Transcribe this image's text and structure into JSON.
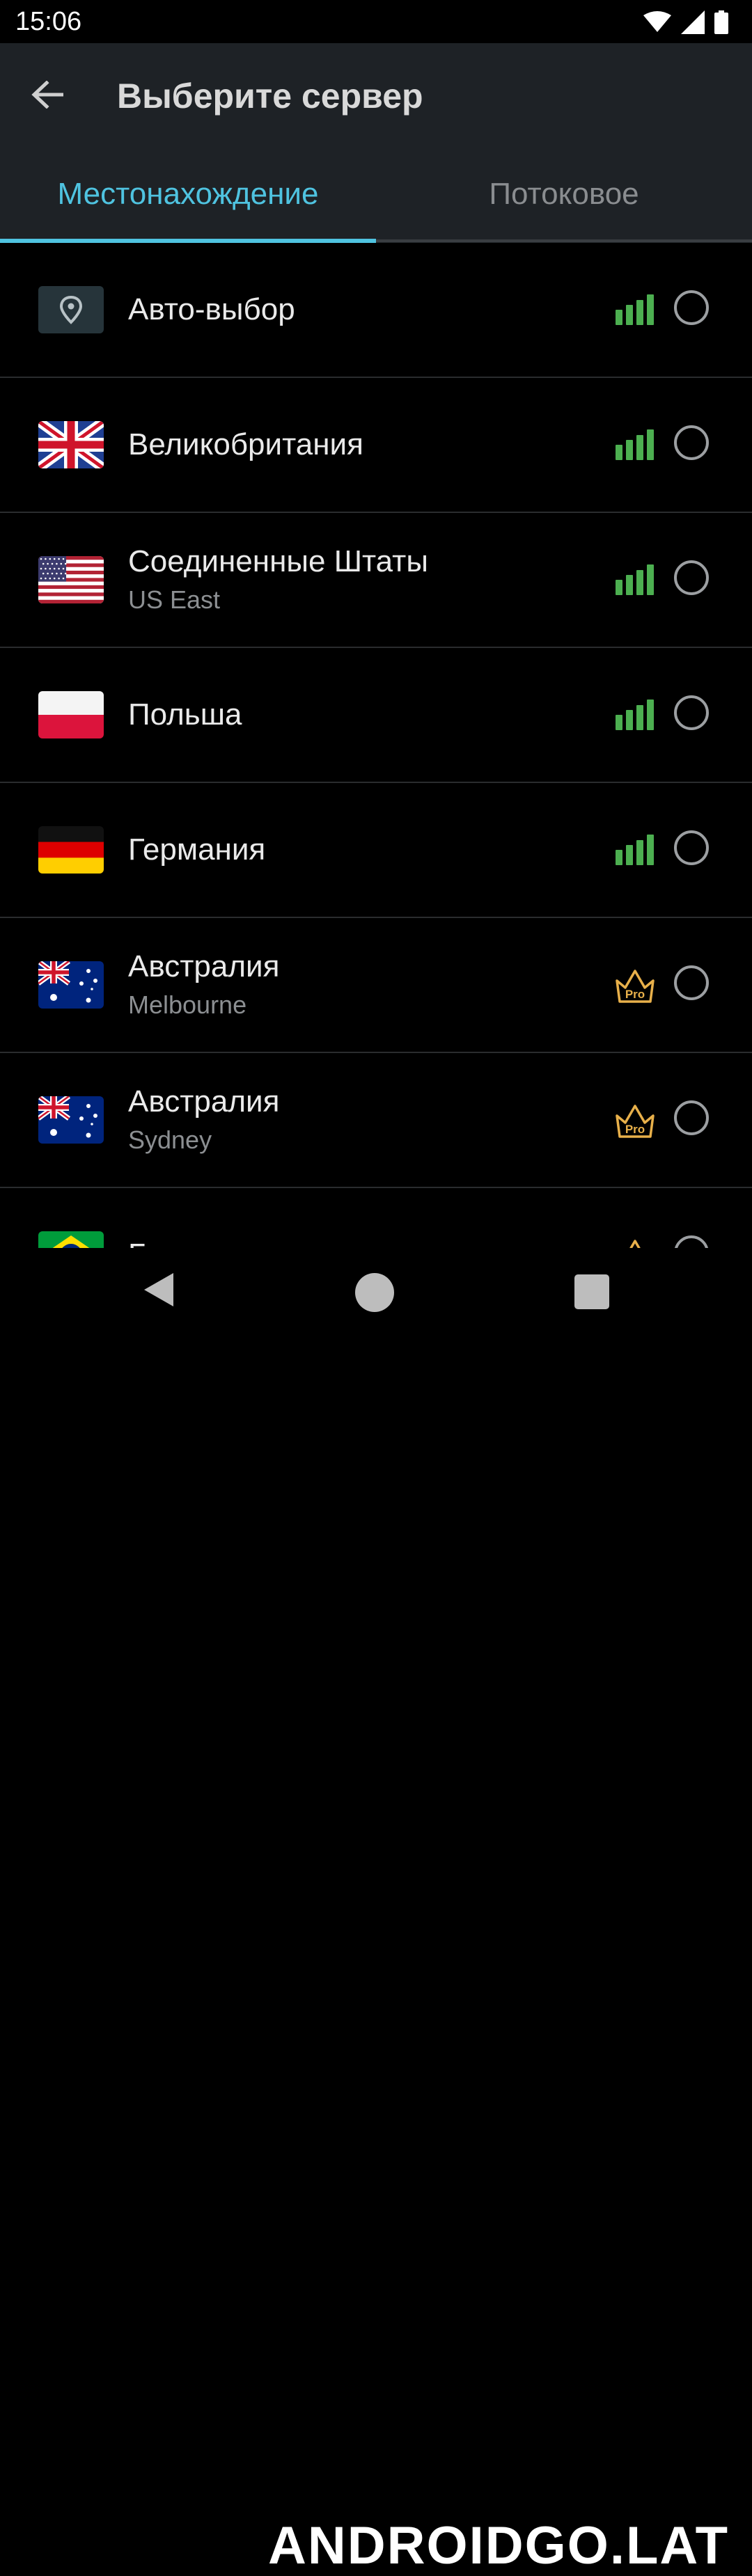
{
  "status_bar": {
    "time": "15:06",
    "icons": [
      "wifi-icon",
      "cell-signal-icon",
      "battery-icon"
    ]
  },
  "app_bar": {
    "title": "Выберите сервер",
    "back_icon": "arrow-left-icon"
  },
  "tabs": [
    {
      "label": "Местонахождение",
      "active": true
    },
    {
      "label": "Потоковое",
      "active": false
    }
  ],
  "servers": [
    {
      "name": "Авто-выбор",
      "subtitle": "",
      "icon": "location-pin-icon",
      "indicator": "signal",
      "selected": false
    },
    {
      "name": "Великобритания",
      "subtitle": "",
      "icon": "flag-uk-icon",
      "indicator": "signal",
      "selected": false
    },
    {
      "name": "Соединенные Штаты",
      "subtitle": "US East",
      "icon": "flag-us-icon",
      "indicator": "signal",
      "selected": false
    },
    {
      "name": "Польша",
      "subtitle": "",
      "icon": "flag-poland-icon",
      "indicator": "signal",
      "selected": false
    },
    {
      "name": "Германия",
      "subtitle": "",
      "icon": "flag-germany-icon",
      "indicator": "signal",
      "selected": false
    },
    {
      "name": "Австралия",
      "subtitle": "Melbourne",
      "icon": "flag-australia-icon",
      "indicator": "pro",
      "selected": false
    },
    {
      "name": "Австралия",
      "subtitle": "Sydney",
      "icon": "flag-australia-icon",
      "indicator": "pro",
      "selected": false
    },
    {
      "name": "Бразилия",
      "subtitle": "",
      "icon": "flag-brazil-icon",
      "indicator": "pro",
      "selected": false
    }
  ],
  "pro_badge_text": "Pro",
  "colors": {
    "accent": "#4fc3e0",
    "signal": "#4caf50",
    "pro": "#e8b04a",
    "appbar": "#1e2226"
  },
  "navigation_bar": {
    "icons": [
      "nav-back-icon",
      "nav-home-icon",
      "nav-recents-icon"
    ]
  },
  "watermark": "ANDROIDGO.LAT"
}
